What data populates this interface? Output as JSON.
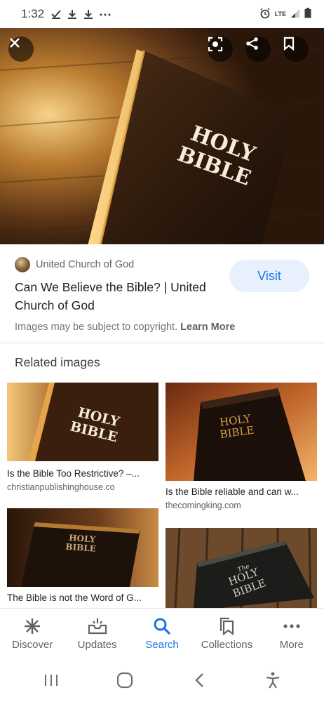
{
  "status_bar": {
    "time": "1:32",
    "icons": [
      "checkmark-icon",
      "download-icon",
      "download-icon",
      "more-dots-icon"
    ],
    "right_icons": [
      "alarm-icon",
      "lte-icon",
      "signal-icon",
      "battery-icon"
    ],
    "network": "LTE"
  },
  "hero": {
    "book_title_line1": "HOLY",
    "book_title_line2": "BIBLE",
    "actions": [
      "close-icon",
      "lens-icon",
      "share-icon",
      "bookmark-icon"
    ]
  },
  "result": {
    "source_name": "United Church of God",
    "title": "Can We Believe the Bible? | United Church of God",
    "visit_label": "Visit",
    "copyright_text": "Images may be subject to copyright.",
    "learn_more": "Learn More"
  },
  "related": {
    "heading": "Related images",
    "items": [
      {
        "caption": "Is the Bible Too Restrictive? –...",
        "domain": "christianpublishinghouse.co",
        "book_text_1": "HOLY",
        "book_text_2": "BIBLE"
      },
      {
        "caption": "Is the Bible reliable and can w...",
        "domain": "thecomingking.com",
        "book_text_1": "HOLY",
        "book_text_2": "BIBLE"
      },
      {
        "caption": "The Bible is not the Word of G...",
        "domain": "",
        "book_text_1": "HOLY",
        "book_text_2": "BIBLE"
      },
      {
        "caption": "",
        "domain": "",
        "book_text_0": "The",
        "book_text_1": "HOLY",
        "book_text_2": "BIBLE"
      }
    ]
  },
  "bottom_nav": {
    "items": [
      {
        "label": "Discover",
        "icon": "asterisk-icon"
      },
      {
        "label": "Updates",
        "icon": "updates-inbox-icon"
      },
      {
        "label": "Search",
        "icon": "search-icon",
        "active": true
      },
      {
        "label": "Collections",
        "icon": "collections-icon"
      },
      {
        "label": "More",
        "icon": "more-dots-icon"
      }
    ]
  },
  "colors": {
    "accent": "#1a73e8",
    "visit_bg": "#e8f0fe",
    "text": "#202124",
    "muted": "#5f6368"
  }
}
